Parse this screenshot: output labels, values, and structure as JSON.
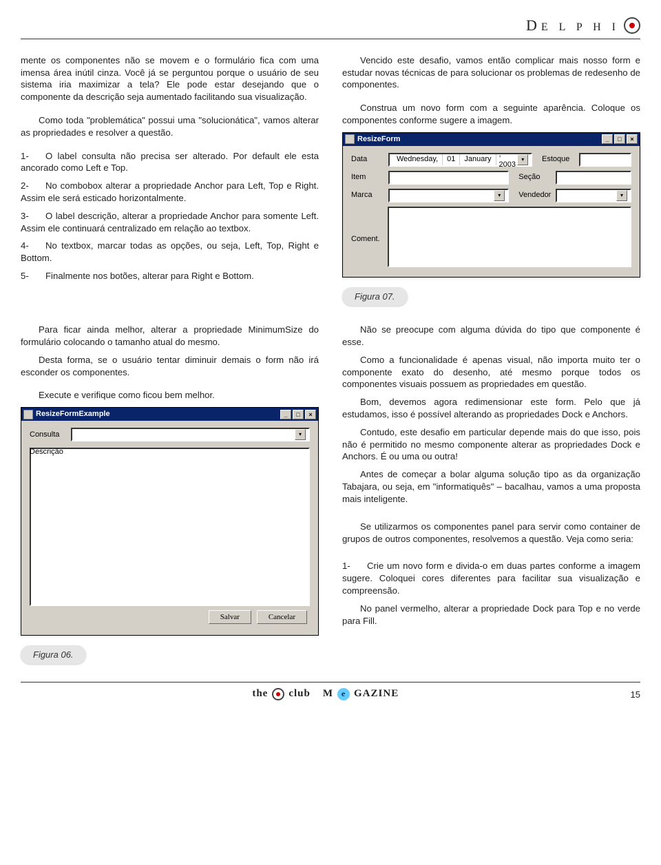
{
  "header": {
    "brand": "DELPHI"
  },
  "left": {
    "p1": "mente os componentes não se movem e o formulário fica com uma imensa área inútil cinza. Você já se perguntou porque o usuário de seu sistema iria maximizar a tela? Ele pode estar desejando que o componente da descrição seja aumentado facilitando sua visualização.",
    "p2": "Como toda \"problemática\" possui uma \"solucionática\", vamos alterar as propriedades e resolver a questão.",
    "items": [
      {
        "n": "1-",
        "t": "O label consulta não precisa ser alterado. Por default ele esta ancorado como Left e Top."
      },
      {
        "n": "2-",
        "t": "No combobox alterar a propriedade Anchor para Left, Top e Right. Assim ele será esticado horizontalmente."
      },
      {
        "n": "3-",
        "t": "O label descrição, alterar a propriedade Anchor para somente Left. Assim ele continuará centralizado em relação ao textbox."
      },
      {
        "n": "4-",
        "t": "No textbox, marcar todas as opções, ou seja, Left, Top, Right e Bottom."
      },
      {
        "n": "5-",
        "t": "Finalmente nos botões, alterar para Right e Bottom."
      }
    ]
  },
  "right": {
    "p1": "Vencido este desafio, vamos então complicar mais nosso form e estudar novas técnicas de para solucionar os problemas de redesenho de componentes.",
    "p2": "Construa um novo form com a seguinte aparência. Coloque os componentes conforme sugere a imagem."
  },
  "form2": {
    "title": "ResizeForm",
    "labels": {
      "data": "Data",
      "item": "Item",
      "marca": "Marca",
      "coment": "Coment.",
      "estoque": "Estoque",
      "secao": "Seção",
      "vendedor": "Vendedor"
    },
    "date": {
      "weekday": "Wednesday,",
      "day": "01",
      "month": "January",
      "year": ", 2003"
    }
  },
  "caption2": "Figura 07.",
  "left2": {
    "p1": "Para ficar ainda melhor, alterar a propriedade MinimumSize do formulário colocando o tamanho atual do mesmo.",
    "p2": "Desta forma, se o usuário tentar diminuir demais o form não irá esconder os componentes.",
    "p3": "Execute e verifique como ficou bem melhor."
  },
  "form1": {
    "title": "ResizeFormExample",
    "labels": {
      "consulta": "Consulta",
      "descricao": "Descrição"
    },
    "buttons": {
      "salvar": "Salvar",
      "cancelar": "Cancelar"
    }
  },
  "caption1": "Figura 06.",
  "right2": {
    "p1": "Não se preocupe com alguma dúvida do tipo que componente é esse.",
    "p2": "Como a funcionalidade é apenas visual, não importa muito ter o componente exato do desenho, até mesmo porque todos os componentes visuais possuem as propriedades em questão.",
    "p3": "Bom, devemos agora redimensionar este form. Pelo que já estudamos, isso é possível alterando as propriedades Dock e Anchors.",
    "p4": "Contudo, este desafio em particular depende mais do que isso, pois não é permitido no mesmo componente alterar as propriedades Dock e Anchors. É ou uma ou outra!",
    "p5": "Antes de começar a bolar alguma solução tipo as da organização Tabajara, ou seja, em \"informatiquês\" – bacalhau, vamos a uma proposta mais inteligente.",
    "p6": "Se utilizarmos os componentes panel para servir como container de grupos de outros componentes, resolvemos a questão. Veja como seria:",
    "item1n": "1-",
    "item1t": "Crie um novo form e divida-o em duas partes conforme a imagem sugere. Coloquei cores diferentes para facilitar sua visualização e compreensão.",
    "p7": "No panel vermelho, alterar a propriedade Dock para Top e no verde para Fill."
  },
  "footer": {
    "brand_left": "the",
    "brand_mid": "club",
    "brand_mag": "M",
    "brand_mag2": "GAZINE",
    "e": "e",
    "page": "15"
  }
}
